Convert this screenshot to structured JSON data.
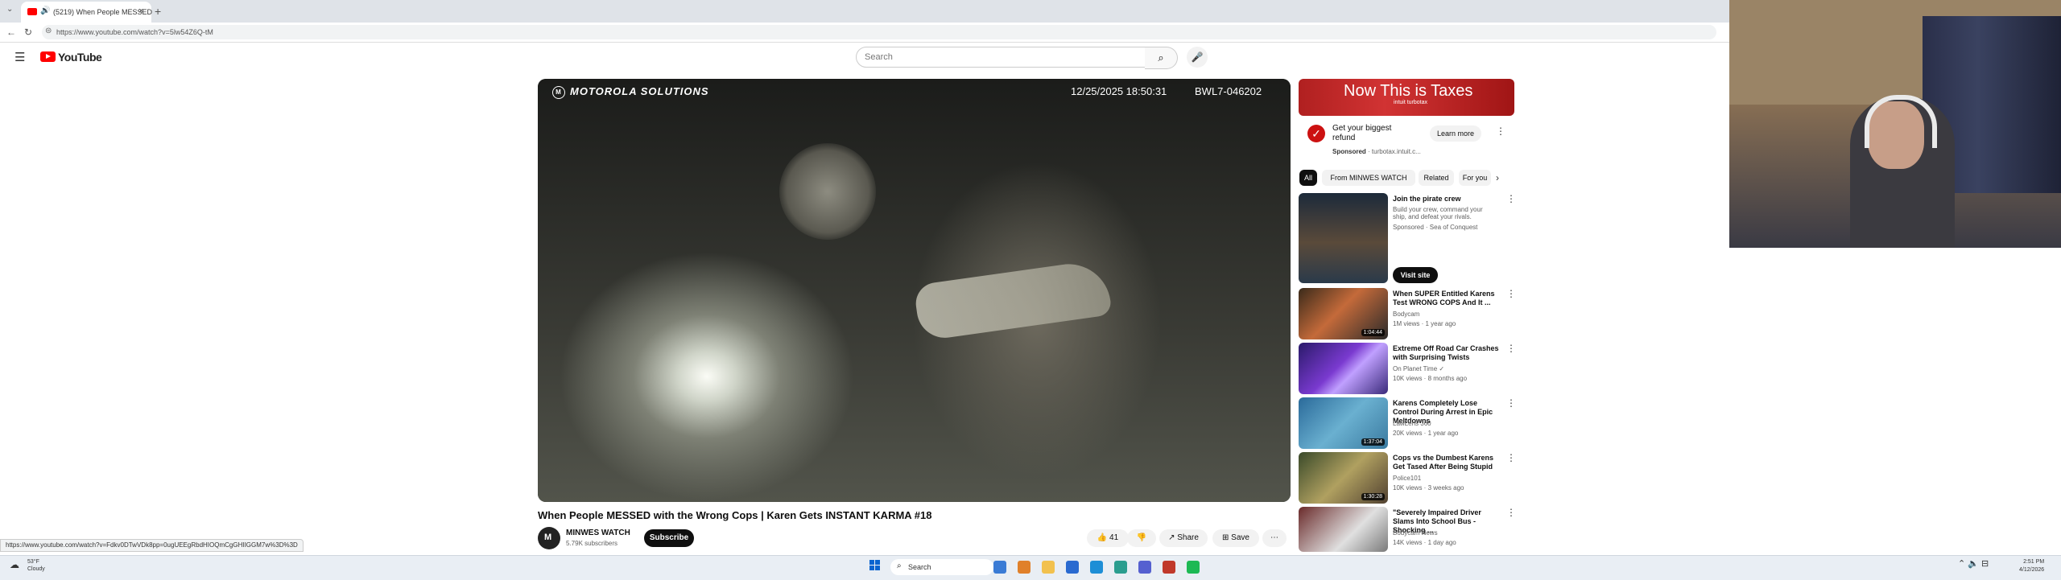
{
  "browser": {
    "tab_title": "(5219) When People MESSED",
    "tab_close": "×",
    "new_tab": "+",
    "tab_menu": "⌄",
    "url": "https://www.youtube.com/watch?v=5lw54Z6Q-tM",
    "back": "←",
    "reload": "↻",
    "status_url": "https://www.youtube.com/watch?v=Fdkv0DTwVDk8pp=0ugUEEgRbdHIOQmCgGHIIGGM7w%3D%3D"
  },
  "youtube": {
    "menu_icon": "☰",
    "logo_text": "YouTube",
    "search_placeholder": "Search",
    "search_icon": "⌕",
    "mic_icon": "🎤"
  },
  "video": {
    "overlay_brand": "MOTOROLA SOLUTIONS",
    "overlay_brand_mark": "M",
    "overlay_timestamp": "12/25/2025 18:50:31",
    "overlay_device": "BWL7-046202",
    "title": "When People MESSED with the Wrong Cops | Karen Gets INSTANT KARMA #18",
    "channel_name": "MINWES WATCH",
    "subscribers": "5.79K subscribers",
    "subscribe_label": "Subscribe",
    "likes": "👍 41",
    "dislike": "👎",
    "share_label": "↗ Share",
    "save_label": "⊞ Save",
    "more": "⋯"
  },
  "ad": {
    "banner_text": "Now This is Taxes",
    "banner_brand": "intuit turbotax",
    "title": "Get your biggest refund",
    "sponsored_label": "Sponsored",
    "advertiser": "· turbotax.intuit.c...",
    "learn_more": "Learn more",
    "menu": "⋮"
  },
  "chips": [
    "All",
    "From MINWES WATCH",
    "Related",
    "For you"
  ],
  "chip_arrow": "›",
  "recommendations": [
    {
      "title": "Join the pirate crew",
      "channel": "Build your crew, command your ship, and defeat your rivals.",
      "meta": "Sponsored · Sea of Conquest",
      "duration": "",
      "cta": "Visit site"
    },
    {
      "title": "When SUPER Entitled Karens Test WRONG COPS And It ...",
      "channel": "Bodycam",
      "meta": "1M views · 1 year ago",
      "duration": "1:04:44"
    },
    {
      "title": "Extreme Off Road Car Crashes with Surprising Twists",
      "channel": "On Planet Time ✓",
      "meta": "10K views · 8 months ago",
      "duration": ""
    },
    {
      "title": "Karens Completely Lose Control During Arrest in Epic Meltdowns",
      "channel": "LawLens 360",
      "meta": "20K views · 1 year ago",
      "duration": "1:37:04"
    },
    {
      "title": "Cops vs the Dumbest Karens Get Tased After Being Stupid",
      "channel": "Police101",
      "meta": "10K views · 3 weeks ago",
      "duration": "1:30:28"
    },
    {
      "title": "\"Severely Impaired Driver Slams Into School Bus - Shocking ...",
      "channel": "Bodycam News",
      "meta": "14K views · 1 day ago",
      "duration": ""
    }
  ],
  "rec_menu": "⋮",
  "taskbar": {
    "weather_temp": "53°F",
    "weather_cond": "Cloudy",
    "weather_icon": "☁",
    "search_label": "Search",
    "search_icon": "⌕",
    "tray": "⌃  🔈 ⊟",
    "time": "2:51 PM",
    "date": "4/12/2026",
    "icon_colors": [
      "#3a7bd5",
      "#e0802a",
      "#f2c14e",
      "#2a6ad0",
      "#1d8ed6",
      "#2a9d8f",
      "#5560d0",
      "#c0392b",
      "#1db954"
    ]
  }
}
